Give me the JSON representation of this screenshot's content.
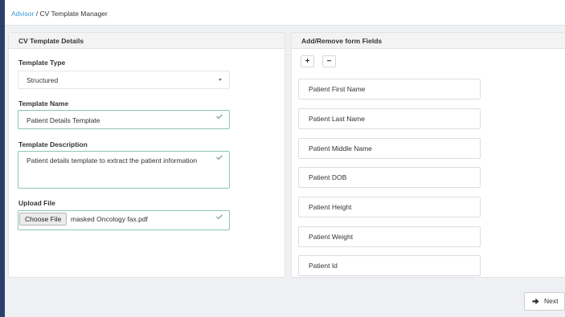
{
  "breadcrumb": {
    "root": "Advisor",
    "separator": " / ",
    "current": "CV Template Manager"
  },
  "left_panel": {
    "title": "CV Template Details",
    "template_type": {
      "label": "Template Type",
      "value": "Structured"
    },
    "template_name": {
      "label": "Template Name",
      "value": "Patient Details Template"
    },
    "template_description": {
      "label": "Template Description",
      "value": "Patient details template to extract the patient information"
    },
    "upload_file": {
      "label": "Upload File",
      "button_label": "Choose File",
      "file_name": "masked Oncology fax.pdf"
    }
  },
  "right_panel": {
    "title": "Add/Remove form Fields",
    "add_symbol": "+",
    "remove_symbol": "−",
    "fields": [
      "Patient First Name",
      "Patient Last Name",
      "Patient Middle Name",
      "Patient DOB",
      "Patient Height",
      "Patient Weight",
      "Patient Id"
    ]
  },
  "next_button": {
    "label": "Next",
    "icon": "arrow-right-icon"
  },
  "colors": {
    "accent_link": "#3a9ad9",
    "sidebar": "#2c3e6b",
    "valid_border": "#8dc6ad",
    "check": "#8aa89a"
  }
}
